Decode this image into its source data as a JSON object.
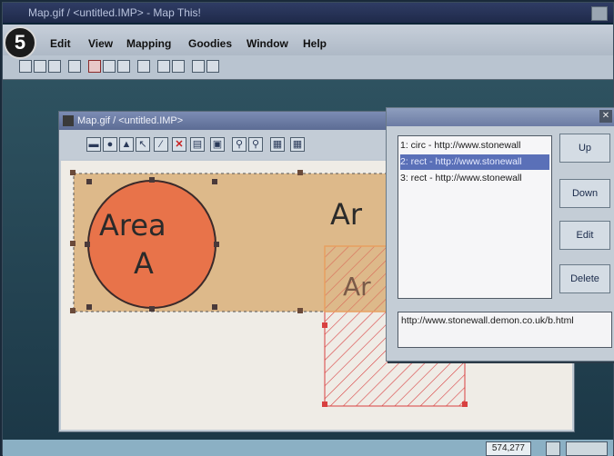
{
  "main_window": {
    "title": "Map.gif / <untitled.IMP> - Map This!",
    "step_badge": "5"
  },
  "menubar": {
    "items": [
      {
        "name": "menu-edit",
        "label": "Edit"
      },
      {
        "name": "menu-view",
        "label": "View"
      },
      {
        "name": "menu-mapping",
        "label": "Mapping"
      },
      {
        "name": "menu-goodies",
        "label": "Goodies"
      },
      {
        "name": "menu-window",
        "label": "Window"
      },
      {
        "name": "menu-help",
        "label": "Help"
      }
    ]
  },
  "child_window": {
    "title": "Map.gif / <untitled.IMP>"
  },
  "canvas": {
    "area_a_line1": "Area",
    "area_a_line2": "A",
    "area_b_partial": "Ar",
    "area_c_partial": "Ar"
  },
  "dialog": {
    "list": [
      "1: circ - http://www.stonewall",
      "2: rect - http://www.stonewall",
      "3: rect - http://www.stonewall"
    ],
    "selected_index": 1,
    "buttons": {
      "up": "Up",
      "down": "Down",
      "edit": "Edit",
      "delete": "Delete"
    },
    "url_value": "http://www.stonewall.demon.co.uk/b.html"
  },
  "status": {
    "coords": "574,277"
  },
  "colors": {
    "circle_fill": "#e8734a",
    "band_fill": "#ddb98a",
    "hatch_red": "#d84040",
    "selection_blue": "#5a70b8"
  }
}
